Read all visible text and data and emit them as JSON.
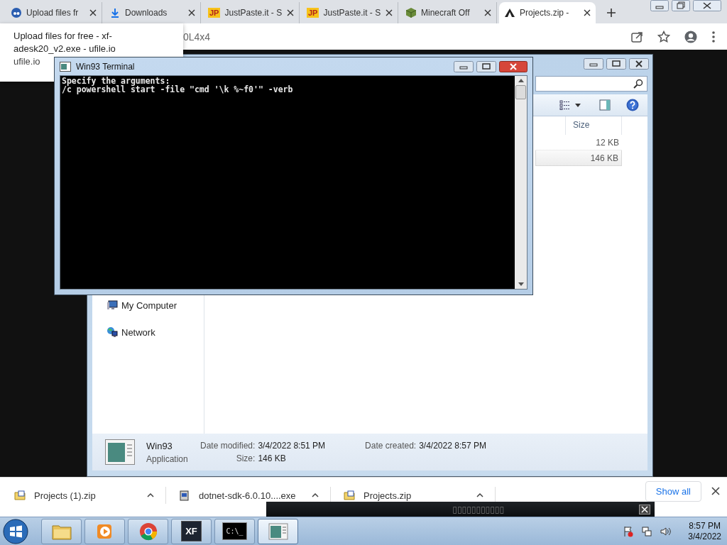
{
  "browser": {
    "tabs": [
      {
        "title": "Upload files fr",
        "kind": "ufile",
        "selected": false
      },
      {
        "title": "Downloads",
        "kind": "download",
        "selected": false
      },
      {
        "title": "JustPaste.it - S",
        "kind": "badge",
        "badge": "JP",
        "selected": false
      },
      {
        "title": "JustPaste.it - S",
        "kind": "badge",
        "badge": "JP",
        "selected": false
      },
      {
        "title": "Minecraft Off",
        "kind": "cube",
        "selected": false
      },
      {
        "title": "Projects.zip -",
        "kind": "archive",
        "selected": true
      }
    ],
    "address": "0L4x4",
    "tooltip": {
      "title_lines": [
        "Upload files for free - xf-",
        "adesk20_v2.exe - ufile.io"
      ],
      "site": "ufile.io"
    }
  },
  "explorer": {
    "columns": [
      {
        "label": "Size"
      }
    ],
    "rows": [
      {
        "size": "12 KB",
        "selected": false
      },
      {
        "size": "146 KB",
        "selected": true
      }
    ],
    "nav_items": [
      {
        "label": "My Computer",
        "kind": "computer"
      },
      {
        "label": "Network",
        "kind": "network"
      }
    ],
    "details": {
      "name": "Win93",
      "type": "Application",
      "field_columns": [
        [
          {
            "label": "Date modified:",
            "value": "3/4/2022 8:51 PM"
          },
          {
            "label": "Size:",
            "value": "146 KB"
          }
        ],
        [
          {
            "label": "Date created:",
            "value": "3/4/2022 8:57 PM"
          }
        ]
      ]
    }
  },
  "terminal": {
    "title": "Win93 Terminal",
    "lines": [
      "Specify the arguments:",
      "/c powershell start -file \"cmd '\\k %~f0'\" -verb"
    ]
  },
  "downloads": {
    "items": [
      {
        "name": "Projects (1).zip",
        "kind": "zip"
      },
      {
        "name": "dotnet-sdk-6.0.10....exe",
        "kind": "installer"
      },
      {
        "name": "Projects.zip",
        "kind": "zip"
      }
    ],
    "show_all": "Show all"
  },
  "overlay": {
    "text": "▯▯▯▯▯▯▯▯▯▯▯"
  },
  "taskbar": {
    "apps": [
      {
        "kind": "folder",
        "selected": false
      },
      {
        "kind": "media",
        "selected": false
      },
      {
        "kind": "chrome",
        "selected": false
      },
      {
        "kind": "xf",
        "label": "XF",
        "selected": false
      },
      {
        "kind": "console",
        "label": "C:\\_",
        "selected": false
      },
      {
        "kind": "app",
        "selected": true
      }
    ],
    "time": "8:57 PM",
    "date": "3/4/2022"
  }
}
